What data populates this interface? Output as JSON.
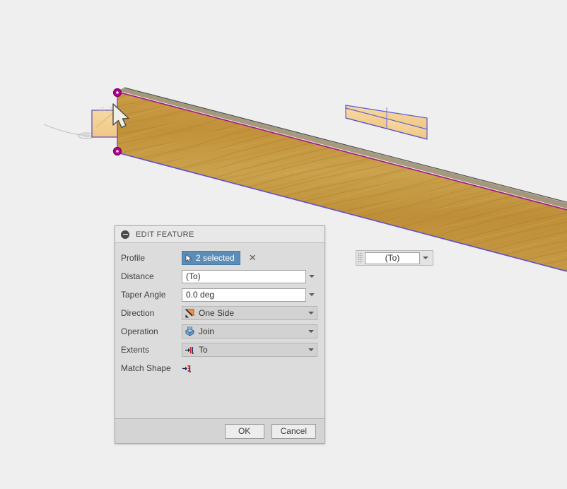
{
  "app": {
    "background_color": "#efefef"
  },
  "viewport": {
    "name": "3d-model-viewport",
    "ghost_dimension_text": "0.71",
    "colors": {
      "wood_face": "#c89a42",
      "wood_top": "#a89878",
      "highlight_profile": "#f5d191",
      "selection_edge": "#5b5bd6",
      "body_edge": "#a0168c",
      "vertex_marker": "#c0009a",
      "construction_line": "#b8b8b8"
    }
  },
  "dialog": {
    "title": "EDIT FEATURE",
    "collapse_icon": "minus-circle-icon",
    "rows": {
      "profile": {
        "label": "Profile",
        "button_text": "2 selected",
        "button_icon": "cursor-arrow-icon",
        "clear_icon": "✕"
      },
      "distance": {
        "label": "Distance",
        "value": "(To)"
      },
      "taper_angle": {
        "label": "Taper Angle",
        "value": "0.0 deg"
      },
      "direction": {
        "label": "Direction",
        "value": "One Side",
        "icon": "one-side-arrow-icon"
      },
      "operation": {
        "label": "Operation",
        "value": "Join",
        "icon": "join-solid-icon"
      },
      "extents": {
        "label": "Extents",
        "value": "To",
        "icon": "extent-to-icon"
      },
      "match_shape": {
        "label": "Match Shape",
        "icon": "match-shape-icon"
      }
    },
    "footer": {
      "ok_label": "OK",
      "cancel_label": "Cancel"
    }
  },
  "floating_input": {
    "name": "floating-distance-input",
    "value": "(To)",
    "grip_icon": "drag-grip-icon",
    "dropdown_icon": "chevron-down-icon"
  }
}
